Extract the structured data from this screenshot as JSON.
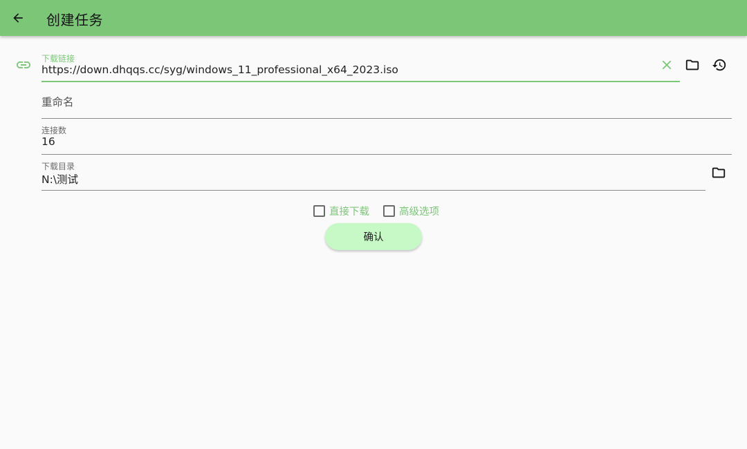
{
  "appbar": {
    "title": "创建任务",
    "back_icon": "arrow-left-icon"
  },
  "colors": {
    "primary": "#7bc777",
    "button_bg": "#c6f9c6",
    "background": "#fafafa"
  },
  "url_field": {
    "label": "下载链接",
    "value": "https://down.dhqqs.cc/syg/windows_11_professional_x64_2023.iso",
    "leading_icon": "link-icon",
    "actions": [
      "clear-icon",
      "folder-icon",
      "history-icon"
    ]
  },
  "rename_field": {
    "placeholder": "重命名",
    "value": ""
  },
  "connections_field": {
    "label": "连接数",
    "value": "16"
  },
  "directory_field": {
    "label": "下载目录",
    "value": "N:\\测试",
    "action": "folder-icon"
  },
  "options": {
    "direct_download": {
      "label": "直接下载",
      "checked": false
    },
    "advanced_options": {
      "label": "高级选项",
      "checked": false
    }
  },
  "confirm_button": {
    "label": "确认"
  }
}
